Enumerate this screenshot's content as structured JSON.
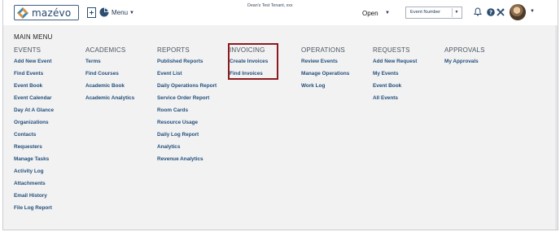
{
  "header": {
    "logo_text": "mazévo",
    "menu_label": "Menu",
    "tenant_text": "Dean's Test Tenant, xxx",
    "status_label": "Open",
    "search_type_value": "Event Number",
    "icons": [
      "logo-diamond-icon",
      "document-icon",
      "pie-chart-icon",
      "bell-icon",
      "help-icon",
      "tools-icon",
      "avatar"
    ]
  },
  "menu": {
    "title": "MAIN MENU",
    "columns": [
      {
        "heading": "EVENTS",
        "items": [
          "Add New Event",
          "Find Events",
          "Event Book",
          "Event Calendar",
          "Day At A Glance",
          "Organizations",
          "Contacts",
          "Requesters",
          "Manage Tasks",
          "Activity Log",
          "Attachments",
          "Email History",
          "File Log Report"
        ]
      },
      {
        "heading": "ACADEMICS",
        "items": [
          "Terms",
          "Find Courses",
          "Academic Book",
          "Academic Analytics"
        ]
      },
      {
        "heading": "REPORTS",
        "items": [
          "Published Reports",
          "Event List",
          "Daily Operations Report",
          "Service Order Report",
          "Room Cards",
          "Resource Usage",
          "Daily Log Report",
          "Analytics",
          "Revenue Analytics"
        ]
      },
      {
        "heading": "INVOICING",
        "items": [
          "Create Invoices",
          "Find Invoices"
        ]
      },
      {
        "heading": "OPERATIONS",
        "items": [
          "Review Events",
          "Manage Operations",
          "Work Log"
        ]
      },
      {
        "heading": "REQUESTS",
        "items": [
          "Add New Request",
          "My Events",
          "Event Book",
          "All Events"
        ]
      },
      {
        "heading": "APPROVALS",
        "items": [
          "My Approvals"
        ]
      }
    ]
  },
  "colors": {
    "link": "#234f7c",
    "highlight_border": "#8c1b20",
    "panel_bg": "#f2f2f2"
  }
}
